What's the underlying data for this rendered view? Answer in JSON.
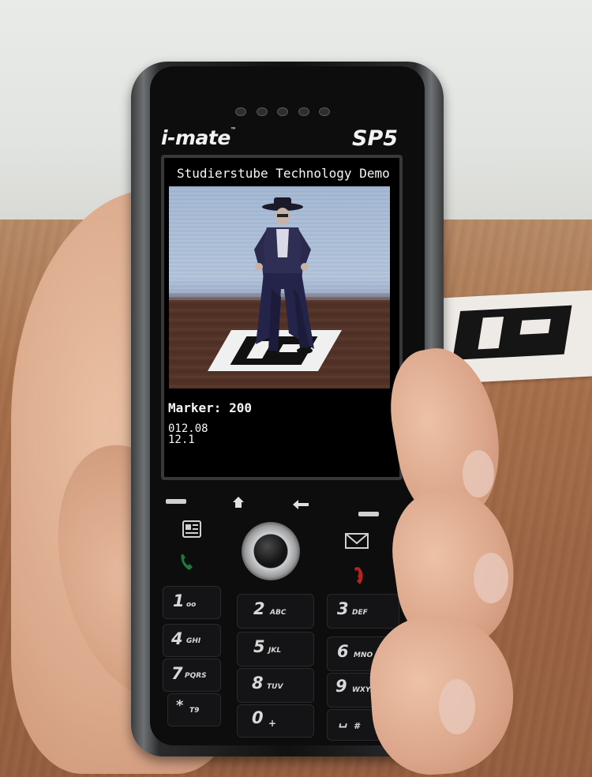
{
  "phone": {
    "brand": "i-mate",
    "trademark": "™",
    "model": "SP5"
  },
  "screen": {
    "title": "Studierstube Technology Demo",
    "marker_label": "Marker: 200",
    "readout_line1": "012.08",
    "readout_line2": "12.1"
  },
  "keypad": {
    "keys": [
      {
        "digit": "1",
        "letters": "ᴏᴏ"
      },
      {
        "digit": "2",
        "letters": "ABC"
      },
      {
        "digit": "3",
        "letters": "DEF"
      },
      {
        "digit": "4",
        "letters": "GHI"
      },
      {
        "digit": "5",
        "letters": "JKL"
      },
      {
        "digit": "6",
        "letters": "MNO"
      },
      {
        "digit": "7",
        "letters": "PQRS"
      },
      {
        "digit": "8",
        "letters": "TUV"
      },
      {
        "digit": "9",
        "letters": "WXYZ"
      },
      {
        "digit": "*",
        "letters": "T9"
      },
      {
        "digit": "0",
        "letters": "+"
      },
      {
        "digit": "␣",
        "letters": "#"
      }
    ]
  },
  "icons": {
    "home": "home-icon",
    "back": "back-arrow-icon",
    "contacts": "contacts-card-icon",
    "message": "envelope-icon",
    "call": "green-handset-icon",
    "end": "red-handset-icon",
    "nav": "joystick-icon"
  },
  "colors": {
    "phone_body": "#111111",
    "screen_text": "#f6f6f6",
    "call_green": "#1f7a3a",
    "end_red": "#b3261e"
  }
}
